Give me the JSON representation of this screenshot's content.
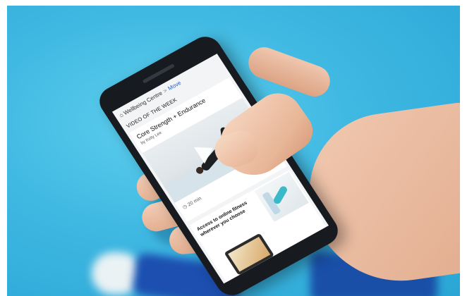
{
  "scene": {
    "background_color": "#3fb8e2",
    "phone_color": "#171a1f",
    "accent_link_color": "#2060c8"
  },
  "screen": {
    "breadcrumb": {
      "home_icon": "home-icon",
      "home_label": "Wellbeing Centre",
      "separator": ">",
      "current_label": "Move"
    },
    "section_title": "VIDEO OF THE WEEK",
    "video_card": {
      "title": "Core Strength + Endurance",
      "author": "by Kelly Lee",
      "duration": "20 min",
      "play_icon": "play-icon",
      "clock_icon": "clock-icon"
    },
    "promo": {
      "text": "Access to online fitness wherever you choose"
    }
  }
}
